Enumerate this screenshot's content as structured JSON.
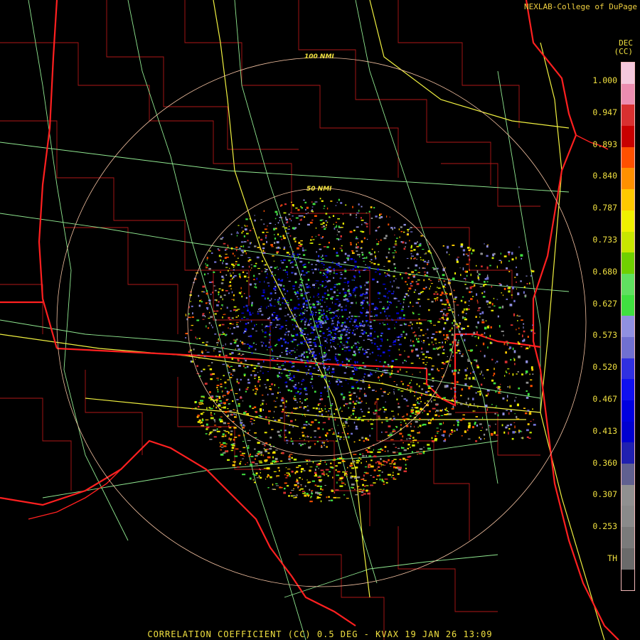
{
  "credit": "NEXLAB-College of DuPage",
  "footer": "CORRELATION COEFFICIENT (CC) 0.5 DEG - KVAX 19 JAN 26 13:09",
  "range_rings": [
    {
      "label": "50 NMI"
    },
    {
      "label": "100 NMI"
    }
  ],
  "legend": {
    "unit_line1": "DEC",
    "unit_line2": "(CC)",
    "ticks": [
      "1.000",
      "0.947",
      "0.893",
      "0.840",
      "0.787",
      "0.733",
      "0.680",
      "0.627",
      "0.573",
      "0.520",
      "0.467",
      "0.413",
      "0.360",
      "0.307",
      "0.253",
      "TH"
    ],
    "colors": [
      "#f5c8dd",
      "#ec8db0",
      "#d83030",
      "#c80000",
      "#ff5000",
      "#ff9000",
      "#ffc800",
      "#f0f000",
      "#c8e600",
      "#70d000",
      "#60e060",
      "#40e040",
      "#9090e0",
      "#7070d0",
      "#3030e0",
      "#1010f0",
      "#0000e0",
      "#0000d0",
      "#2020b0",
      "#606090",
      "#909090",
      "#8a8a8a",
      "#7a7a7a",
      "#6a6a6a",
      "#000000"
    ]
  },
  "colors": {
    "state_border": "#ff2020",
    "county_border": "#c01818",
    "highway": "#f0f040",
    "road": "#90e890",
    "ring": "#f2c0a0"
  }
}
